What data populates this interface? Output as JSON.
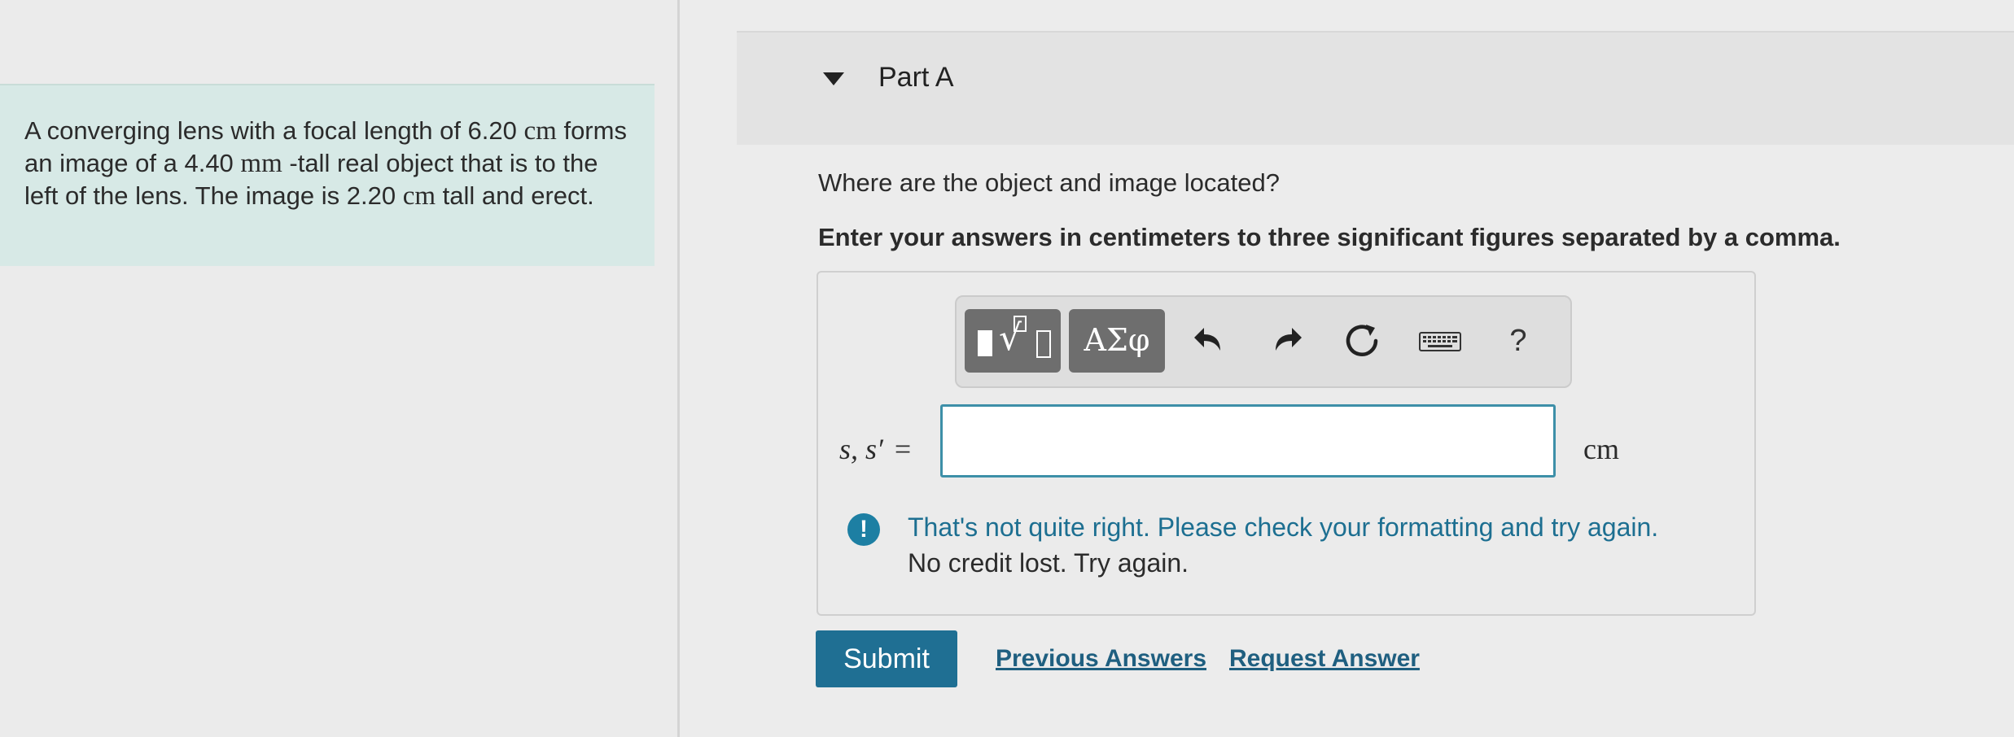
{
  "problem": {
    "text_1": "A converging lens with a focal length of 6.20 ",
    "unit_1": "cm",
    "text_2": " forms an image of a 4.40 ",
    "unit_2": "mm",
    "text_3": " -tall real object that is to the left of the lens. The image is 2.20 ",
    "unit_3": "cm",
    "text_4": " tall and erect."
  },
  "part": {
    "title": "Part A",
    "question": "Where are the object and image located?",
    "instructions": "Enter your answers in centimeters to three significant figures separated by a comma."
  },
  "toolbar": {
    "greek_label": "ΑΣφ",
    "help_label": "?",
    "icons": [
      "templates-icon",
      "greek-letters-icon",
      "undo-icon",
      "redo-icon",
      "reset-icon",
      "keyboard-icon",
      "help-icon"
    ]
  },
  "answer": {
    "variable_label": "s, s′",
    "equals": "=",
    "value": "",
    "unit": "cm"
  },
  "feedback": {
    "icon": "!",
    "message": "That's not quite right. Please check your formatting and try again.",
    "sub_message": "No credit lost. Try again."
  },
  "actions": {
    "submit_label": "Submit",
    "previous_answers_label": "Previous Answers",
    "request_answer_label": "Request Answer"
  },
  "colors": {
    "problem_bg": "#d7e9e6",
    "accent": "#1f6f93",
    "feedback": "#1d7fa3"
  }
}
